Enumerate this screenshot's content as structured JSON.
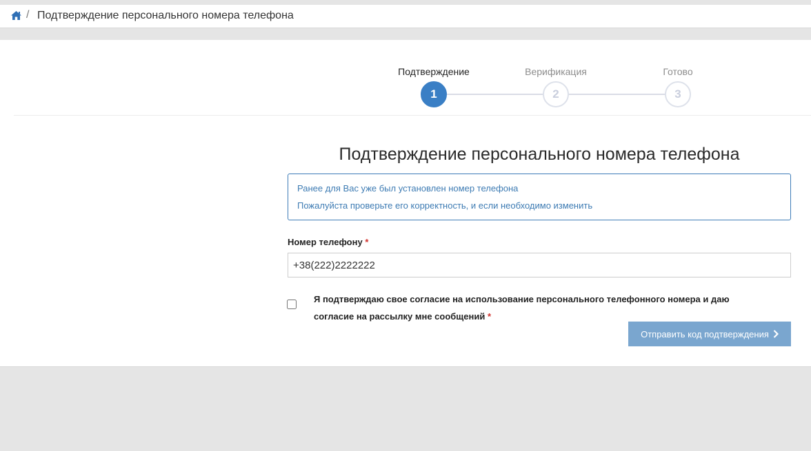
{
  "breadcrumb": {
    "separator": "/",
    "title": "Подтверждение персонального номера телефона"
  },
  "steps": [
    {
      "label": "Подтверждение",
      "number": "1",
      "state": "active"
    },
    {
      "label": "Верификация",
      "number": "2",
      "state": "inactive"
    },
    {
      "label": "Готово",
      "number": "3",
      "state": "inactive"
    }
  ],
  "form": {
    "title": "Подтверждение персонального номера телефона",
    "info_lines": [
      "Ранее для Вас уже был установлен номер телефона",
      "Пожалуйста проверьте его корректность, и если необходимо изменить"
    ],
    "phone_label": "Номер телефону",
    "required_mark": "*",
    "phone_value": "+38(222)2222222",
    "consent_text": "Я подтверждаю свое согласие на использование персонального телефонного номера и даю согласие на рассылку мне сообщений",
    "consent_checked": false,
    "submit_label": "Отправить код подтверждения"
  },
  "colors": {
    "accent": "#3a7fc5",
    "button": "#7aa6cf",
    "required": "#d0312d"
  },
  "icons": {
    "home": "home-icon",
    "submit_chevron": "chevron-right-icon"
  }
}
